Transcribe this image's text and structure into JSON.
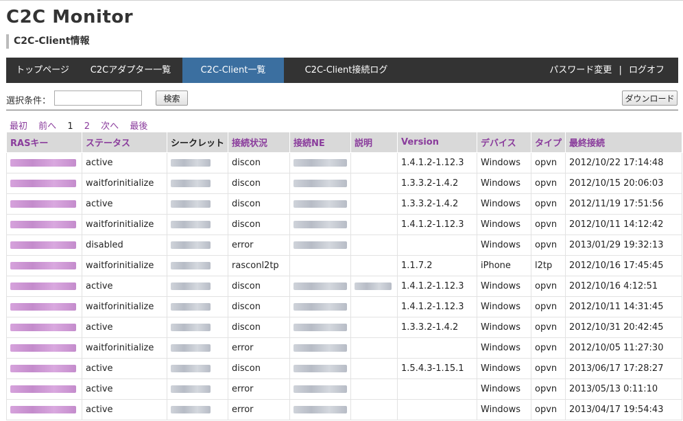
{
  "app": {
    "title": "C2C Monitor",
    "page_title": "C2C-Client情報"
  },
  "nav": {
    "items": [
      {
        "label": "トップページ",
        "active": false
      },
      {
        "label": "C2Cアダプター一覧",
        "active": false
      },
      {
        "label": "C2C-Client一覧",
        "active": true
      },
      {
        "label": "C2C-Client接続ログ",
        "active": false
      }
    ],
    "change_password": "パスワード変更",
    "separator": "|",
    "logoff": "ログオフ"
  },
  "filter": {
    "label": "選択条件：",
    "value": "",
    "search_button": "検索",
    "download_button": "ダウンロード"
  },
  "pagination": {
    "first": "最初",
    "prev": "前へ",
    "current": "1",
    "page2": "2",
    "next": "次へ",
    "last": "最後"
  },
  "table": {
    "headers": [
      "RASキー",
      "ステータス",
      "シークレット",
      "接続状況",
      "接続NE",
      "説明",
      "Version",
      "デバイス",
      "タイプ",
      "最終接続"
    ],
    "rows": [
      {
        "status": "active",
        "conn": "discon",
        "version": "1.4.1.2-1.12.3",
        "device": "Windows",
        "type": "opvn",
        "last": "2012/10/22 17:14:48",
        "has_ne": true,
        "has_desc": false
      },
      {
        "status": "waitforinitialize",
        "conn": "discon",
        "version": "1.3.3.2-1.4.2",
        "device": "Windows",
        "type": "opvn",
        "last": "2012/10/15 20:06:03",
        "has_ne": true,
        "has_desc": false
      },
      {
        "status": "active",
        "conn": "discon",
        "version": "1.3.3.2-1.4.2",
        "device": "Windows",
        "type": "opvn",
        "last": "2012/11/19 17:51:56",
        "has_ne": true,
        "has_desc": false
      },
      {
        "status": "waitforinitialize",
        "conn": "discon",
        "version": "1.4.1.2-1.12.3",
        "device": "Windows",
        "type": "opvn",
        "last": "2012/10/11 14:12:42",
        "has_ne": true,
        "has_desc": false
      },
      {
        "status": "disabled",
        "conn": "error",
        "version": "",
        "device": "Windows",
        "type": "opvn",
        "last": "2013/01/29 19:32:13",
        "has_ne": true,
        "has_desc": false
      },
      {
        "status": "waitforinitialize",
        "conn": "rasconl2tp",
        "version": "1.1.7.2",
        "device": "iPhone",
        "type": "l2tp",
        "last": "2012/10/16 17:45:45",
        "has_ne": false,
        "has_desc": false
      },
      {
        "status": "active",
        "conn": "discon",
        "version": "1.4.1.2-1.12.3",
        "device": "Windows",
        "type": "opvn",
        "last": "2012/10/16 4:12:51",
        "has_ne": true,
        "has_desc": true
      },
      {
        "status": "waitforinitialize",
        "conn": "discon",
        "version": "1.4.1.2-1.12.3",
        "device": "Windows",
        "type": "opvn",
        "last": "2012/10/11 14:31:45",
        "has_ne": true,
        "has_desc": false
      },
      {
        "status": "active",
        "conn": "discon",
        "version": "1.3.3.2-1.4.2",
        "device": "Windows",
        "type": "opvn",
        "last": "2012/10/31 20:42:45",
        "has_ne": true,
        "has_desc": false
      },
      {
        "status": "waitforinitialize",
        "conn": "error",
        "version": "",
        "device": "Windows",
        "type": "opvn",
        "last": "2012/10/05 11:27:30",
        "has_ne": true,
        "has_desc": false
      },
      {
        "status": "active",
        "conn": "discon",
        "version": "1.5.4.3-1.15.1",
        "device": "Windows",
        "type": "opvn",
        "last": "2013/06/17 17:28:27",
        "has_ne": true,
        "has_desc": false
      },
      {
        "status": "active",
        "conn": "error",
        "version": "",
        "device": "Windows",
        "type": "opvn",
        "last": "2013/05/13 0:11:10",
        "has_ne": true,
        "has_desc": false
      },
      {
        "status": "active",
        "conn": "error",
        "version": "",
        "device": "Windows",
        "type": "opvn",
        "last": "2013/04/17 19:54:43",
        "has_ne": true,
        "has_desc": false
      }
    ]
  },
  "colors": {
    "nav_bg": "#333333",
    "nav_active": "#3b6fa0",
    "link": "#8a3c9c",
    "header_bg": "#d9d9d9"
  }
}
